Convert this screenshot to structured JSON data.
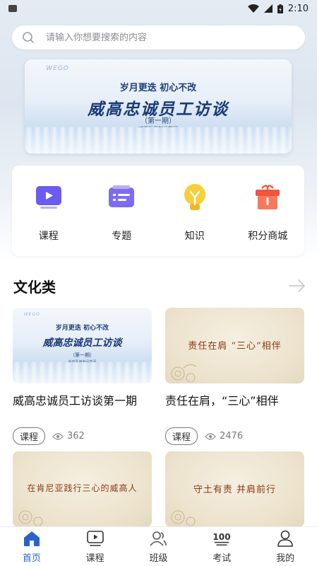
{
  "status_bar": {
    "time": "2:10"
  },
  "search": {
    "placeholder": "请输入你想要搜索的内容"
  },
  "banner": {
    "slogan": "岁月更迭 初心不改",
    "title": "威高忠诚员工访谈",
    "issue": "（第一期）",
    "org": "威高医用制品集团"
  },
  "quick_nav": [
    {
      "label": "课程",
      "icon": "course-play-icon",
      "color": "#6a5cf0"
    },
    {
      "label": "专题",
      "icon": "topic-list-icon",
      "color": "#7d6cf2"
    },
    {
      "label": "知识",
      "icon": "lightbulb-icon",
      "color": "#f4c22e"
    },
    {
      "label": "积分商城",
      "icon": "gift-box-icon",
      "color": "#f0553d"
    }
  ],
  "section": {
    "title": "文化类"
  },
  "cards": [
    {
      "title": "威高忠诚员工访谈第一期",
      "tag": "课程",
      "views": "362",
      "thumb": {
        "slogan": "岁月更迭 初心不改",
        "title": "威高忠诚员工访谈",
        "issue": "（第一期）",
        "org": "威高医用制品集团"
      }
    },
    {
      "title": "责任在肩，“三心”相伴",
      "tag": "课程",
      "views": "2476",
      "thumb_text": "责任在肩 “三心”相伴"
    },
    {
      "thumb_text": "在肯尼亚践行三心的威高人"
    },
    {
      "thumb_text": "守土有责 并肩前行"
    }
  ],
  "tab_bar": [
    {
      "label": "首页",
      "icon": "home-icon",
      "active": true
    },
    {
      "label": "课程",
      "icon": "video-play-icon",
      "active": false
    },
    {
      "label": "班级",
      "icon": "class-people-icon",
      "active": false
    },
    {
      "label": "考试",
      "icon": "exam-100-icon",
      "active": false
    },
    {
      "label": "我的",
      "icon": "profile-icon",
      "active": false
    }
  ],
  "colors": {
    "accent": "#2a63c7",
    "title_blue": "#1b3a78",
    "parchment_text": "#8a3a18"
  }
}
